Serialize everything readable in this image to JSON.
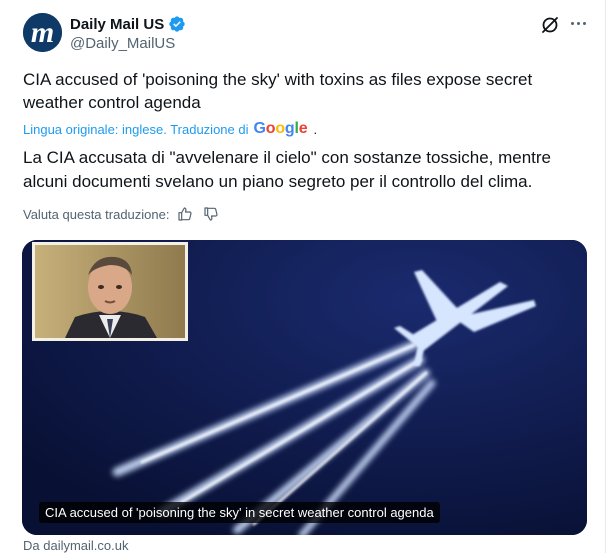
{
  "tweet": {
    "author": {
      "display_name": "Daily Mail US",
      "handle": "@Daily_MailUS",
      "avatar_glyph": "m",
      "verified": true
    },
    "original_text": "CIA accused of 'poisoning the sky' with toxins as files expose secret weather control agenda",
    "translation_label": "Lingua originale: inglese. Traduzione di",
    "translation_provider": "Google",
    "translation_suffix": ".",
    "translated_text": "La CIA accusata di \"avvelenare il cielo\" con sostanze tossiche, mentre alcuni documenti svelano un piano segreto per il controllo del clima.",
    "rate_translation_label": "Valuta questa traduzione:",
    "card": {
      "caption": "CIA accused of 'poisoning the sky' in secret weather control agenda",
      "source": "Da dailymail.co.uk"
    }
  },
  "colors": {
    "accent": "#1d9bf0",
    "muted_text": "#536471",
    "avatar_bg": "#0f3a68",
    "sky": "#0b1640"
  },
  "icons": [
    "verified-badge-icon",
    "grok-icon",
    "more-icon",
    "thumbs-up-icon",
    "thumbs-down-icon"
  ]
}
